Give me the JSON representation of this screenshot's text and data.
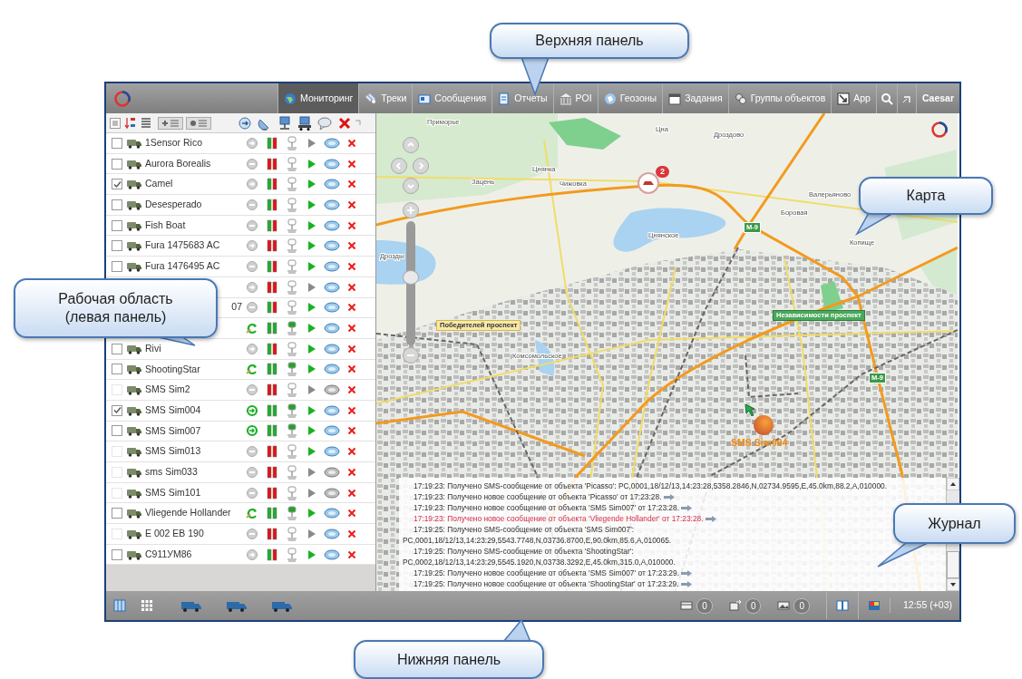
{
  "top_bar": {
    "tabs": [
      {
        "label": "Мониторинг",
        "selected": true
      },
      {
        "label": "Треки",
        "selected": false
      },
      {
        "label": "Сообщения",
        "selected": false
      },
      {
        "label": "Отчеты",
        "selected": false
      },
      {
        "label": "POI",
        "selected": false
      },
      {
        "label": "Геозоны",
        "selected": false
      },
      {
        "label": "Задания",
        "selected": false
      },
      {
        "label": "Группы объектов",
        "selected": false
      },
      {
        "label": "App",
        "selected": false
      }
    ],
    "user": "Caesar"
  },
  "objects": [
    {
      "name": "1Sensor Rico",
      "checked": false,
      "disabled": false,
      "status": {
        "kind": "idle"
      },
      "signal": {
        "kind": "mixed"
      },
      "device_active": false,
      "play_active": false,
      "sms_active": true
    },
    {
      "name": "Aurora Borealis",
      "checked": false,
      "disabled": false,
      "status": {
        "kind": "stopped"
      },
      "signal": {
        "kind": "red"
      },
      "device_active": false,
      "play_active": true,
      "sms_active": true
    },
    {
      "name": "Camel",
      "checked": true,
      "disabled": false,
      "status": {
        "kind": "idle"
      },
      "signal": {
        "kind": "mixed"
      },
      "device_active": false,
      "play_active": true,
      "sms_active": true
    },
    {
      "name": "Desesperado",
      "checked": false,
      "disabled": false,
      "status": {
        "kind": "stopped"
      },
      "signal": {
        "kind": "mixed"
      },
      "device_active": false,
      "play_active": true,
      "sms_active": true
    },
    {
      "name": "Fish Boat",
      "checked": false,
      "disabled": false,
      "status": {
        "kind": "stopped"
      },
      "signal": {
        "kind": "mixed"
      },
      "device_active": false,
      "play_active": true,
      "sms_active": true
    },
    {
      "name": "Fura 1475683 AC",
      "checked": false,
      "disabled": false,
      "status": {
        "kind": "idle"
      },
      "signal": {
        "kind": "red"
      },
      "device_active": false,
      "play_active": true,
      "sms_active": true
    },
    {
      "name": "Fura 1476495 AC",
      "checked": false,
      "disabled": false,
      "status": {
        "kind": "stopped"
      },
      "signal": {
        "kind": "mixed"
      },
      "device_active": false,
      "play_active": true,
      "sms_active": true
    },
    {
      "status": {
        "kind": "idle"
      },
      "signal": {
        "kind": "red"
      },
      "device_active": false,
      "play_active": false,
      "sms_active": true
    },
    {
      "name": "07",
      "clipped": true,
      "status": {
        "kind": "stopped"
      },
      "signal": {
        "kind": "mixed"
      },
      "device_active": false,
      "play_active": true,
      "sms_active": true
    },
    {
      "status": {
        "kind": "refreshing"
      },
      "signal": {
        "kind": "green"
      },
      "device_active": true,
      "play_active": true,
      "sms_active": true
    },
    {
      "name": "Rivi",
      "checked": false,
      "disabled": false,
      "status": {
        "kind": "idle"
      },
      "signal": {
        "kind": "mixed"
      },
      "device_active": false,
      "play_active": true,
      "sms_active": true
    },
    {
      "name": "ShootingStar",
      "checked": false,
      "disabled": false,
      "status": {
        "kind": "refreshing"
      },
      "signal": {
        "kind": "green"
      },
      "device_active": true,
      "play_active": true,
      "sms_active": true
    },
    {
      "name": "SMS Sim2",
      "checked": false,
      "disabled": true,
      "status": {
        "kind": "stopped"
      },
      "signal": {
        "kind": "red"
      },
      "device_active": false,
      "play_active": false,
      "sms_active": false
    },
    {
      "name": "SMS Sim004",
      "checked": true,
      "disabled": false,
      "status": {
        "kind": "moving"
      },
      "signal": {
        "kind": "green"
      },
      "device_active": true,
      "play_active": true,
      "sms_active": true
    },
    {
      "name": "SMS Sim007",
      "checked": false,
      "disabled": false,
      "status": {
        "kind": "moving"
      },
      "signal": {
        "kind": "green"
      },
      "device_active": true,
      "play_active": true,
      "sms_active": true
    },
    {
      "name": "SMS Sim013",
      "checked": false,
      "disabled": true,
      "status": {
        "kind": "stopped"
      },
      "signal": {
        "kind": "red"
      },
      "device_active": false,
      "play_active": true,
      "sms_active": true
    },
    {
      "name": "sms Sim033",
      "checked": false,
      "disabled": true,
      "status": {
        "kind": "stopped"
      },
      "signal": {
        "kind": "red"
      },
      "device_active": false,
      "play_active": false,
      "sms_active": false
    },
    {
      "name": "SMS Sim101",
      "checked": false,
      "disabled": true,
      "status": {
        "kind": "stopped"
      },
      "signal": {
        "kind": "red"
      },
      "device_active": false,
      "play_active": false,
      "sms_active": false
    },
    {
      "name": "Vliegende Hollander",
      "checked": false,
      "disabled": false,
      "status": {
        "kind": "refreshing"
      },
      "signal": {
        "kind": "green"
      },
      "device_active": true,
      "play_active": true,
      "sms_active": true
    },
    {
      "name": "E 002 EB 190",
      "checked": false,
      "disabled": true,
      "status": {
        "kind": "stopped"
      },
      "signal": {
        "kind": "red"
      },
      "device_active": false,
      "play_active": false,
      "sms_active": true
    },
    {
      "name": "C911УМ86",
      "checked": false,
      "disabled": false,
      "status": {
        "kind": "idle"
      },
      "signal": {
        "kind": "mixed"
      },
      "device_active": false,
      "play_active": true,
      "sms_active": true
    }
  ],
  "map": {
    "labels": [
      "Приморье",
      "Цна",
      "Дроздово",
      "Зацень",
      "Цнянка",
      "Чижовка",
      "Валерьяново",
      "Боровая",
      "Копище",
      "Цнянское",
      "Дрозды",
      "Комсомольское"
    ],
    "streets": [
      "Победителей проспект",
      "Независимости проспект"
    ],
    "road_signs": [
      "M-9",
      "M-9"
    ],
    "cluster_count": "2",
    "unit_label": "SMS Sim004",
    "zoom": {
      "level": 0.55
    }
  },
  "log": [
    {
      "kind": "sms",
      "alert": false,
      "text": "17:19:23: Получено SMS-сообщение от объекта 'Picasso': PC,0001,18/12/13,14:23:28,5358.2846,N,02734.9595,E,45.0km,88.2,A,010000."
    },
    {
      "kind": "message",
      "alert": false,
      "text": "17:19:23: Получено новое сообщение от объекта 'Picasso' от 17:23:28."
    },
    {
      "kind": "message",
      "alert": false,
      "text": "17:19:23: Получено новое сообщение от объекта 'SMS Sim007' от 17:23:28."
    },
    {
      "kind": "message",
      "alert": true,
      "text": "17:19:23: Получено новое сообщение от объекта 'Vliegende Hollander' от 17:23:28."
    },
    {
      "kind": "sms",
      "alert": false,
      "text": "17:19:25: Получено SMS-сообщение от объекта 'SMS Sim007': PC,0001,18/12/13,14:23:29,5543.7748,N,03736.8700,E,90.0km,85.6,A,010065."
    },
    {
      "kind": "sms",
      "alert": false,
      "text": "17:19:25: Получено SMS-сообщение от объекта 'ShootingStar': PC,0002,18/12/13,14:23:29,5545.1920,N,03738.3292,E,45.0km,315.0,A,010000."
    },
    {
      "kind": "message",
      "alert": false,
      "text": "17:19:25: Получено новое сообщение от объекта 'SMS Sim007' от 17:23:29."
    },
    {
      "kind": "message",
      "alert": false,
      "text": "17:19:25: Получено новое сообщение от объекта 'ShootingStar' от 17:23:29."
    }
  ],
  "bottom_bar": {
    "counters": [
      "0",
      "0",
      "0"
    ],
    "time": "12:55 (+03)"
  },
  "annotations": [
    "Верхняя панель",
    "Карта",
    "Рабочая область (левая панель)",
    "Журнал",
    "Нижняя панель"
  ]
}
